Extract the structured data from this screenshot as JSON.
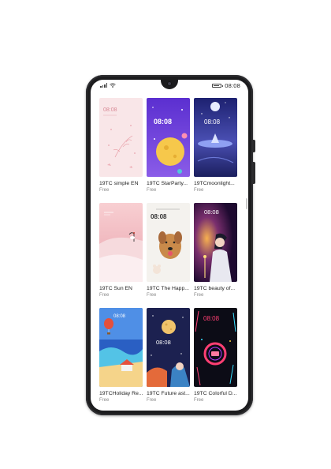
{
  "status_bar": {
    "time": "08:08",
    "signal_icon": "signal-icon",
    "wifi_icon": "wifi-icon",
    "battery_icon": "battery-icon"
  },
  "themes": [
    {
      "title": "19TC simple EN",
      "price": "Free",
      "clock": "08:08",
      "palette": [
        "#f9e4e6",
        "#e79aa3"
      ]
    },
    {
      "title": "19TC StarParty...",
      "price": "Free",
      "clock": "08:08",
      "palette": [
        "#6a3fd3",
        "#f6c84b"
      ]
    },
    {
      "title": "19TCmoonlight...",
      "price": "Free",
      "clock": "08:08",
      "palette": [
        "#2b2f8f",
        "#a9b7f4"
      ]
    },
    {
      "title": "19TC Sun EN",
      "price": "Free",
      "clock": "",
      "palette": [
        "#f3b3b8",
        "#ffffff"
      ]
    },
    {
      "title": "19TC The Happ...",
      "price": "Free",
      "clock": "08:08",
      "palette": [
        "#f5f3ef",
        "#c88845"
      ]
    },
    {
      "title": "19TC beauty of...",
      "price": "Free",
      "clock": "08:08",
      "palette": [
        "#2a0f3e",
        "#f3a04a"
      ]
    },
    {
      "title": "19TCHoliday Re...",
      "price": "Free",
      "clock": "08:08",
      "palette": [
        "#1a3e8f",
        "#f5d48a"
      ]
    },
    {
      "title": "19TC Future ast...",
      "price": "Free",
      "clock": "08:08",
      "palette": [
        "#1b1f4d",
        "#f0c36b"
      ]
    },
    {
      "title": "19TC Colorful D...",
      "price": "Free",
      "clock": "08:08",
      "palette": [
        "#0a0a12",
        "#ff3f73"
      ]
    }
  ]
}
